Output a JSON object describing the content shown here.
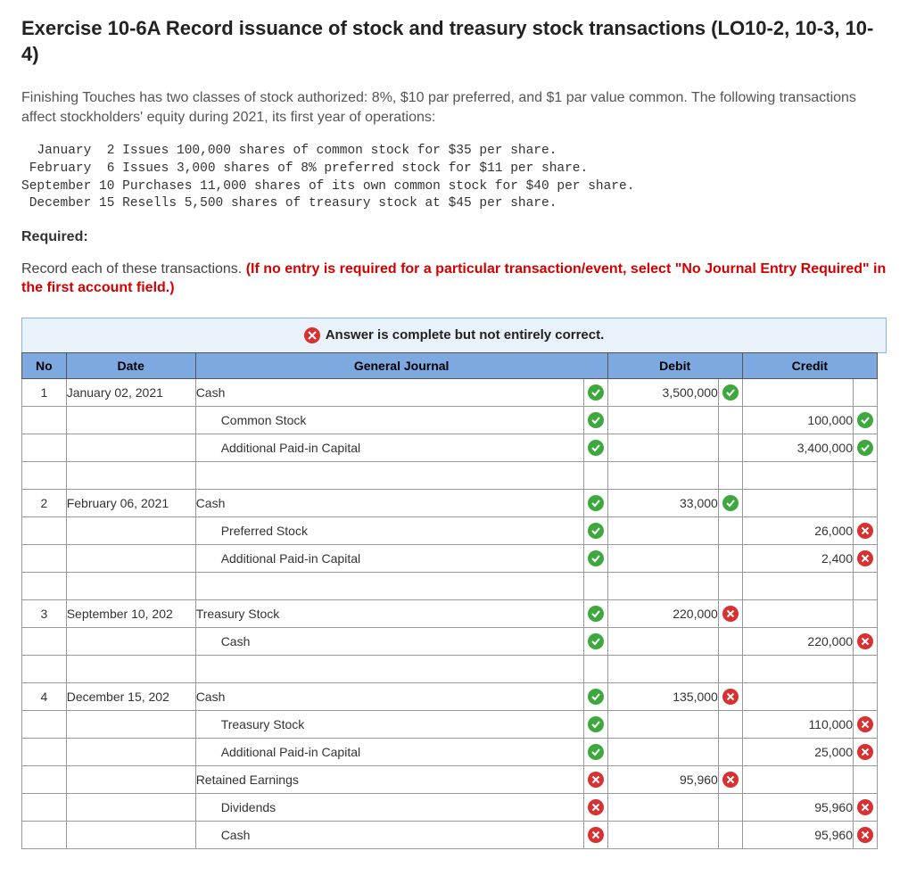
{
  "title": "Exercise 10-6A Record issuance of stock and treasury stock transactions (LO10-2, 10-3, 10-4)",
  "intro": "Finishing Touches has two classes of stock authorized: 8%, $10 par preferred, and $1 par value common. The following transactions affect stockholders' equity during 2021, its first year of operations:",
  "txn_block": "  January  2 Issues 100,000 shares of common stock for $35 per share.\n February  6 Issues 3,000 shares of 8% preferred stock for $11 per share.\nSeptember 10 Purchases 11,000 shares of its own common stock for $40 per share.\n December 15 Resells 5,500 shares of treasury stock at $45 per share.",
  "required_label": "Required:",
  "record_text_plain": "Record each of these transactions. ",
  "record_text_red": "(If no entry is required for a particular transaction/event, select \"No Journal Entry Required\" in the first account field.)",
  "status_message": "Answer is complete but not entirely correct.",
  "headers": {
    "no": "No",
    "date": "Date",
    "gj": "General Journal",
    "debit": "Debit",
    "credit": "Credit"
  },
  "rows": [
    {
      "no": "1",
      "date": "January 02, 2021",
      "gj": "Cash",
      "indent": false,
      "m1": "check",
      "debit": "3,500,000",
      "m2": "check",
      "credit": "",
      "m3": ""
    },
    {
      "no": "",
      "date": "",
      "gj": "Common Stock",
      "indent": true,
      "m1": "check",
      "debit": "",
      "m2": "",
      "credit": "100,000",
      "m3": "check"
    },
    {
      "no": "",
      "date": "",
      "gj": "Additional Paid-in Capital",
      "indent": true,
      "m1": "check",
      "debit": "",
      "m2": "",
      "credit": "3,400,000",
      "m3": "check"
    },
    {
      "no": "",
      "date": "",
      "gj": "",
      "indent": false,
      "m1": "",
      "debit": "",
      "m2": "",
      "credit": "",
      "m3": ""
    },
    {
      "no": "2",
      "date": "February 06, 2021",
      "gj": "Cash",
      "indent": false,
      "m1": "check",
      "debit": "33,000",
      "m2": "check",
      "credit": "",
      "m3": ""
    },
    {
      "no": "",
      "date": "",
      "gj": "Preferred Stock",
      "indent": true,
      "m1": "check",
      "debit": "",
      "m2": "",
      "credit": "26,000",
      "m3": "x",
      "credit_wrong": true
    },
    {
      "no": "",
      "date": "",
      "gj": "Additional Paid-in Capital",
      "indent": true,
      "m1": "check",
      "debit": "",
      "m2": "",
      "credit": "2,400",
      "m3": "x",
      "credit_wrong": true
    },
    {
      "no": "",
      "date": "",
      "gj": "",
      "indent": false,
      "m1": "",
      "debit": "",
      "m2": "",
      "credit": "",
      "m3": ""
    },
    {
      "no": "3",
      "date": "September 10, 202",
      "gj": "Treasury Stock",
      "indent": false,
      "m1": "check",
      "debit": "220,000",
      "m2": "x",
      "credit": "",
      "m3": "",
      "debit_wrong": true
    },
    {
      "no": "",
      "date": "",
      "gj": "Cash",
      "indent": true,
      "m1": "check",
      "debit": "",
      "m2": "",
      "credit": "220,000",
      "m3": "x",
      "credit_wrong": true
    },
    {
      "no": "",
      "date": "",
      "gj": "",
      "indent": false,
      "m1": "",
      "debit": "",
      "m2": "",
      "credit": "",
      "m3": ""
    },
    {
      "no": "4",
      "date": "December 15, 202",
      "gj": "Cash",
      "indent": false,
      "m1": "check",
      "debit": "135,000",
      "m2": "x",
      "credit": "",
      "m3": "",
      "debit_wrong": true
    },
    {
      "no": "",
      "date": "",
      "gj": "Treasury Stock",
      "indent": true,
      "m1": "check",
      "debit": "",
      "m2": "",
      "credit": "110,000",
      "m3": "x",
      "credit_wrong": true
    },
    {
      "no": "",
      "date": "",
      "gj": "Additional Paid-in Capital",
      "indent": true,
      "m1": "check",
      "debit": "",
      "m2": "",
      "credit": "25,000",
      "m3": "x",
      "credit_wrong": true
    },
    {
      "no": "",
      "date": "",
      "gj": "Retained Earnings",
      "indent": false,
      "m1": "x",
      "debit": "95,960",
      "m2": "x",
      "credit": "",
      "m3": "",
      "debit_wrong": true,
      "gj_wrong": true
    },
    {
      "no": "",
      "date": "",
      "gj": "Dividends",
      "indent": true,
      "m1": "x",
      "debit": "",
      "m2": "",
      "credit": "95,960",
      "m3": "x",
      "credit_wrong": true,
      "gj_wrong": true
    },
    {
      "no": "",
      "date": "",
      "gj": "Cash",
      "indent": true,
      "m1": "x",
      "debit": "",
      "m2": "",
      "credit": "95,960",
      "m3": "x",
      "credit_wrong": true,
      "gj_wrong": true
    }
  ]
}
